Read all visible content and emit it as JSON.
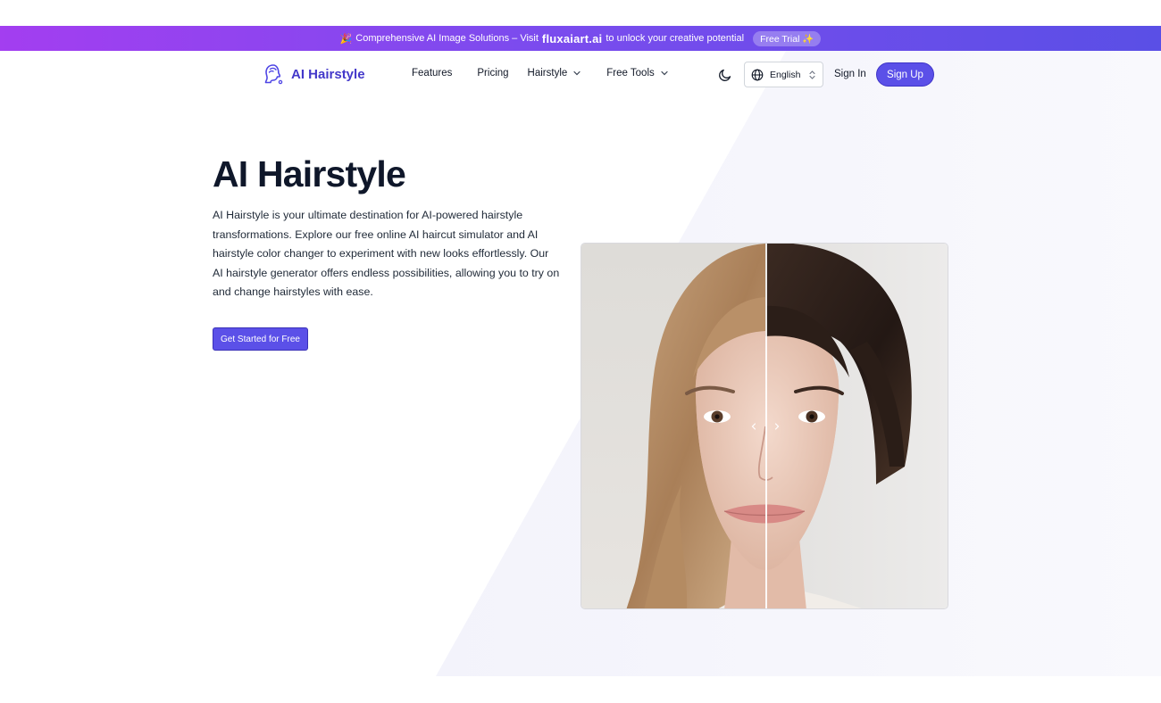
{
  "banner": {
    "text": "Comprehensive AI Image Solutions – Visit",
    "brand": "fluxaiart.ai",
    "suffix": "to unlock your creative potential",
    "trial_label": "Free Trial ✨",
    "emoji": "🎉"
  },
  "nav": {
    "logo_text": "AI Hairstyle",
    "links": [
      {
        "label": "Features"
      },
      {
        "label": "Pricing"
      },
      {
        "label": "Hairstyle"
      },
      {
        "label": "Free Tools"
      }
    ],
    "language": "English",
    "sign_in": "Sign In",
    "sign_up": "Sign Up"
  },
  "hero": {
    "title": "AI Hairstyle",
    "description": "AI Hairstyle is your ultimate destination for AI-powered hairstyle transformations. Explore our free online AI haircut simulator and AI hairstyle color changer to experiment with new looks effortlessly. Our AI hairstyle generator offers endless possibilities, allowing you to try on and change hairstyles with ease.",
    "cta_label": "Get Started for Free"
  },
  "colors": {
    "accent": "#5b50e8",
    "logo": "#4338ca",
    "banner_start": "#a33ef0",
    "banner_end": "#5a4fe6"
  },
  "icons": {
    "logo": "head-silhouette-icon",
    "theme": "moon-icon",
    "language": "globe-icon",
    "select": "chevron-up-down-icon",
    "dropdown": "chevron-down-icon"
  }
}
